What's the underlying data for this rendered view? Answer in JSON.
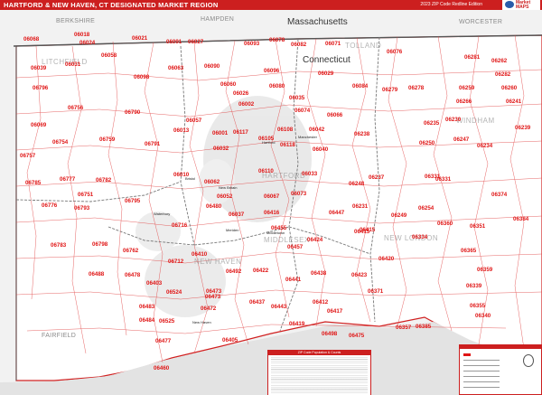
{
  "header": {
    "title": "HARTFORD & NEW HAVEN, CT DESIGNATED MARKET REGION",
    "edition": "2023 ZIP Code Redline Edition",
    "logo_text": "MarketMAPS",
    "color_bar": "#cc1f1f"
  },
  "labels": {
    "states": [
      {
        "name": "Massachusetts"
      },
      {
        "name": "Connecticut"
      }
    ],
    "counties_outside": [
      "BERKSHIRE",
      "HAMPDEN",
      "WORCESTER",
      "FAIRFIELD"
    ],
    "counties_inside": [
      "LITCHFIELD",
      "TOLLAND",
      "HARTFORD",
      "WINDHAM",
      "NEW HAVEN",
      "MIDDLESEX",
      "NEW LONDON"
    ],
    "towns": [
      "Hartford",
      "Waterbury",
      "New Haven",
      "Bristol",
      "Meriden",
      "Middletown",
      "Manchester",
      "New Britain"
    ]
  },
  "zips": [
    "06018",
    "06024",
    "06021",
    "06091",
    "06027",
    "06093",
    "06078",
    "06082",
    "06071",
    "06076",
    "06281",
    "06262",
    "06068",
    "06058",
    "06063",
    "06090",
    "06096",
    "06029",
    "06282",
    "06039",
    "06031",
    "06098",
    "06060",
    "06080",
    "06084",
    "06279",
    "06278",
    "06259",
    "06260",
    "06796",
    "06026",
    "06035",
    "06266",
    "06241",
    "06756",
    "06790",
    "06057",
    "06002",
    "06074",
    "06066",
    "06235",
    "06230",
    "06069",
    "06013",
    "06001",
    "06117",
    "06108",
    "06042",
    "06238",
    "06250",
    "06239",
    "06754",
    "06759",
    "06791",
    "06032",
    "06105",
    "06118",
    "06040",
    "06247",
    "06234",
    "06757",
    "06010",
    "06062",
    "06110",
    "06033",
    "06248",
    "06237",
    "06331",
    "06785",
    "06777",
    "06782",
    "06751",
    "06795",
    "06052",
    "06067",
    "06073",
    "06231",
    "06254",
    "06374",
    "06776",
    "06793",
    "06480",
    "06037",
    "06416",
    "06447",
    "06249",
    "06360",
    "06351",
    "06384",
    "06716",
    "06410",
    "06455",
    "06424",
    "06415",
    "06334",
    "06365",
    "06783",
    "06798",
    "06762",
    "06712",
    "06492",
    "06422",
    "06457",
    "06423",
    "06359",
    "06488",
    "06478",
    "06403",
    "06524",
    "06473",
    "06437",
    "06441",
    "06438",
    "06420",
    "06339",
    "06483",
    "06525",
    "06472",
    "06443",
    "06412",
    "06371",
    "06355",
    "06484",
    "06477",
    "06405",
    "06419",
    "06417",
    "06498",
    "06357",
    "06385",
    "06340",
    "06460",
    "06475",
    "06473",
    "06331",
    "06415"
  ],
  "legend": {
    "title": "ZIP Code Population & Counts"
  }
}
